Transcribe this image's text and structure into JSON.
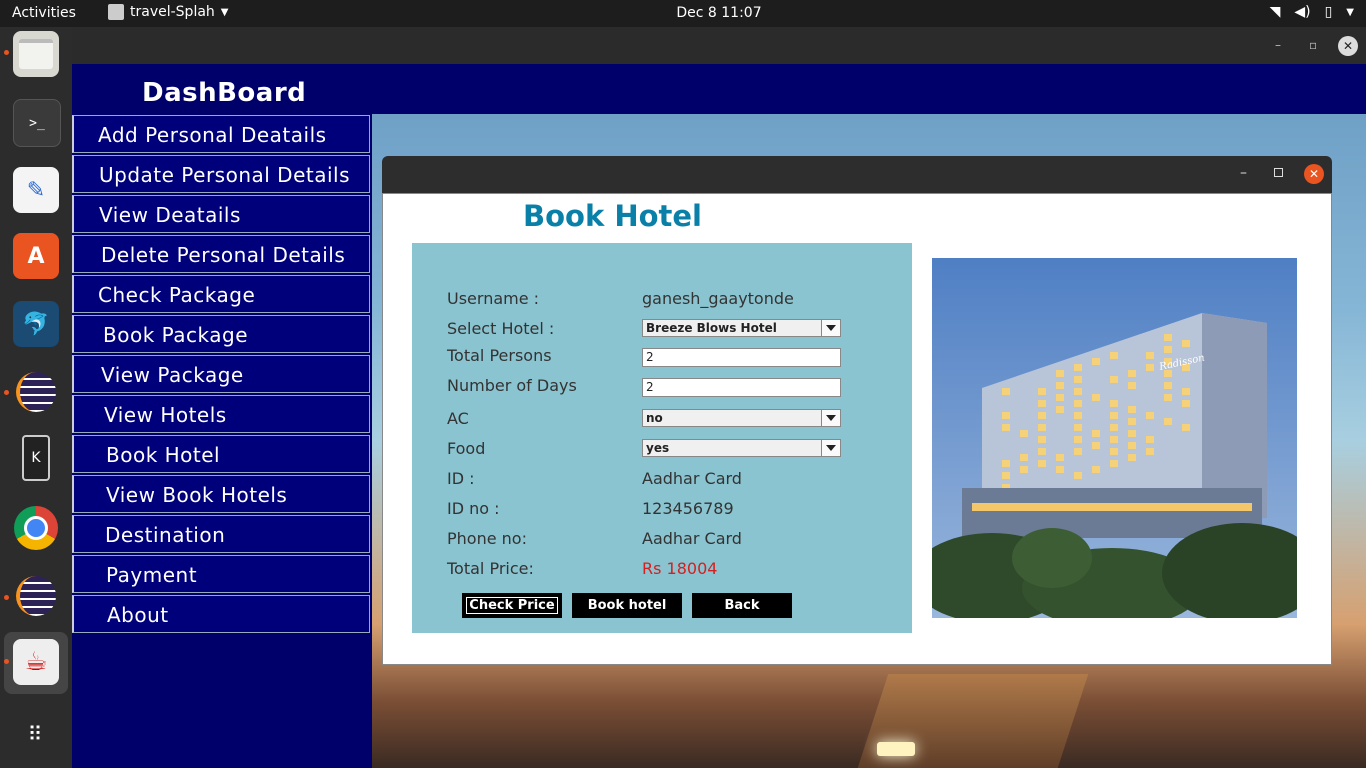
{
  "topbar": {
    "activities": "Activities",
    "app_name": "travel-Splah",
    "clock": "Dec 8  11:07"
  },
  "dock": {
    "icons": [
      "files-icon",
      "terminal-icon",
      "text-editor-icon",
      "software-center-icon",
      "mysql-workbench-icon",
      "eclipse-icon",
      "kde-connect-icon",
      "chrome-icon",
      "eclipse-icon-2",
      "java-app-icon",
      "show-apps-icon"
    ]
  },
  "dashboard": {
    "title": "DashBoard",
    "menu": [
      "Add Personal Deatails",
      "Update Personal Details",
      "View Deatails",
      "Delete Personal Details",
      "Check Package",
      "Book Package",
      "View Package",
      "View Hotels",
      "Book Hotel",
      "View Book Hotels",
      "Destination",
      "Payment",
      "About"
    ]
  },
  "dialog": {
    "title": "Book Hotel",
    "labels": {
      "username": "Username :",
      "select_hotel": "Select Hotel :",
      "total_persons": "Total Persons",
      "number_of_days": "Number of Days",
      "ac": "AC",
      "food": "Food",
      "id": "ID :",
      "id_no": "ID no :",
      "phone": "Phone no:",
      "total_price": "Total Price:"
    },
    "values": {
      "username": "ganesh_gaaytonde",
      "select_hotel": "Breeze Blows Hotel",
      "total_persons": "2",
      "number_of_days": "2",
      "ac": "no",
      "food": "yes",
      "id": "Aadhar Card",
      "id_no": "123456789",
      "phone": "Aadhar Card",
      "total_price": "Rs 18004"
    },
    "buttons": {
      "check_price": "Check Price",
      "book_hotel": "Book hotel",
      "back": "Back"
    },
    "photo_sign": "Radisson"
  },
  "colors": {
    "dashboard_bg": "#00006b",
    "form_panel": "#8ac4d0",
    "title_color": "#0a7fa8",
    "price_color": "#d42020",
    "close_accent": "#e95420"
  }
}
